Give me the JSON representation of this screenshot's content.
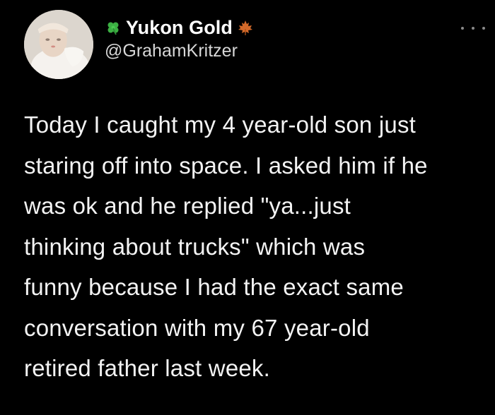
{
  "tweet": {
    "display_name": "Yukon Gold",
    "handle": "@GrahamKritzer",
    "text": "Today I caught my 4 year-old son just\nstaring off into space. I asked him if he\nwas ok and he replied \"ya...just\nthinking about trucks\" which was\nfunny because I had the exact same\nconversation with my 67 year-old\nretired father last week.",
    "icons": {
      "before_name": "four-leaf-clover-icon",
      "after_name": "maple-leaf-icon",
      "menu": "more-options-icon"
    }
  },
  "colors": {
    "background": "#000000",
    "text": "#f3f3f3",
    "handle": "#d7d7d7",
    "clover": "#3cb043",
    "maple": "#d46a2a"
  }
}
